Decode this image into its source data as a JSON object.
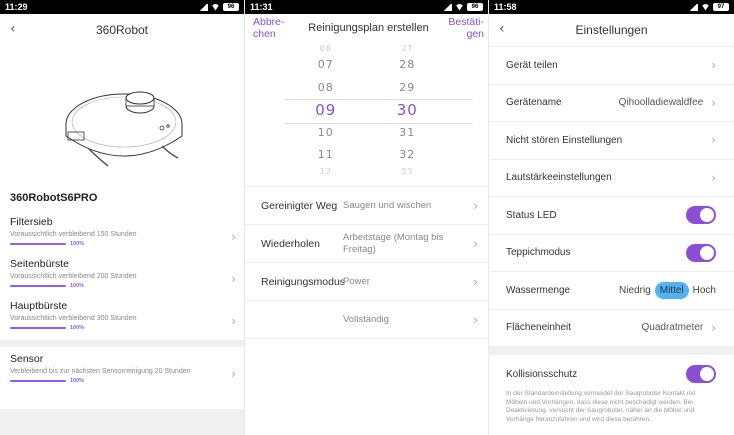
{
  "screen1": {
    "time": "11:29",
    "battery": "96",
    "title": "360Robot",
    "device_name": "360RobotS6PRO",
    "parts": [
      {
        "title": "Filtersieb",
        "desc": "Voraussichtlich verbleibend 150 Stunden",
        "percent": "100%",
        "progress": 1.0
      },
      {
        "title": "Seitenbürste",
        "desc": "Voraussichtlich verbleibend 200 Stunden",
        "percent": "100%",
        "progress": 1.0
      },
      {
        "title": "Hauptbürste",
        "desc": "Voraussichtlich verbleibend 300 Stunden",
        "percent": "100%",
        "progress": 1.0
      }
    ],
    "sensor": {
      "title": "Sensor",
      "desc": "Verbleibend bis zur nächsten Sensorreinigung 20 Stunden",
      "percent": "100%",
      "progress": 1.0
    }
  },
  "screen2": {
    "time": "11:31",
    "battery": "96",
    "cancel": "Abbre-\nchen",
    "title": "Reinigungsplan erstellen",
    "confirm": "Bestäti-\ngen",
    "hours": [
      "06",
      "07",
      "08",
      "09",
      "10",
      "11",
      "12"
    ],
    "minutes": [
      "27",
      "28",
      "29",
      "30",
      "31",
      "32",
      "33"
    ],
    "rows": [
      {
        "label": "Gereinigter Weg",
        "value": "Saugen und wischen"
      },
      {
        "label": "Wiederholen",
        "value": "Arbeitstage (Montag bis Freitag)"
      },
      {
        "label": "Reinigungsmodus",
        "value": "Power"
      },
      {
        "label": "",
        "value": "Vollständig"
      }
    ]
  },
  "screen3": {
    "time": "11:58",
    "battery": "97",
    "title": "Einstellungen",
    "share": "Gerät teilen",
    "device_name_label": "Gerätename",
    "device_name_value": "Qihoolladiewaldfee",
    "dnd": "Nicht stören Einstellungen",
    "volume": "Lautstärkeeinstellungen",
    "status_led": "Status LED",
    "carpet": "Teppichmodus",
    "water": "Wassermenge",
    "water_options": [
      "Niedrig",
      "Mittel",
      "Hoch"
    ],
    "area_unit": "Flächeneinheit",
    "area_unit_value": "Quadratmeter",
    "collision": "Kollisionsschutz",
    "collision_desc": "In der Standardeinstellung vermeidet der Saugroboter Kontakt mit Möbeln und Vorhängen, dass diese nicht beschädigt werden. Bei Deaktivierung, versucht der Saugroboter, näher an die Möbel und Vorhänge heranzufahren und wird diese berühren.",
    "accent": "#8a4fd3",
    "active_seg_color": "#4fb3f6"
  }
}
